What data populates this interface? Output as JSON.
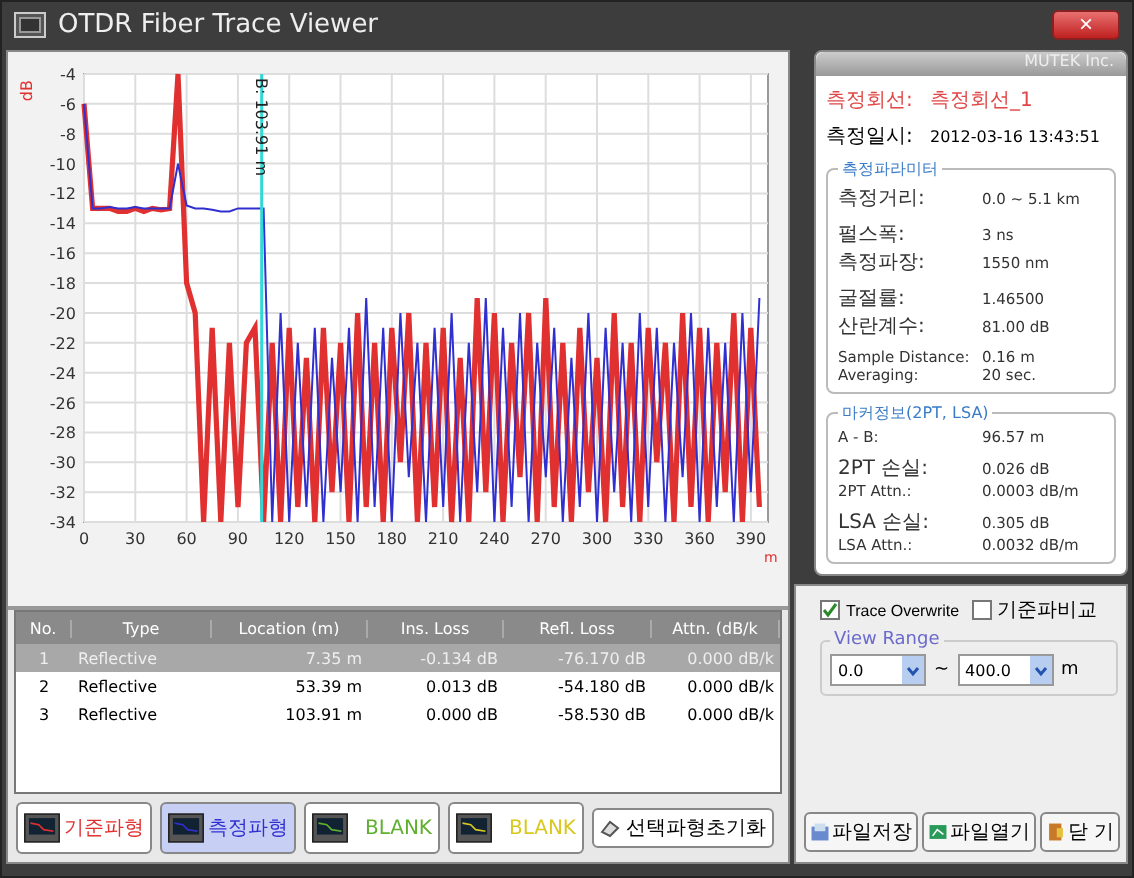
{
  "window": {
    "title": "OTDR Fiber Trace Viewer",
    "close": "×"
  },
  "chart": {
    "chart_data": {
      "type": "line",
      "grid": true,
      "ylabel": "dB",
      "xlabel": "m",
      "xlim": [
        0,
        400
      ],
      "ylim": [
        -34,
        -4
      ],
      "annotations": [
        {
          "x": 103.91,
          "text": "B: 103.91 m"
        }
      ],
      "xticks": [
        0,
        30,
        60,
        90,
        120,
        150,
        180,
        210,
        240,
        270,
        300,
        330,
        360,
        390
      ],
      "yticks": [
        -4,
        -6,
        -8,
        -10,
        -12,
        -14,
        -16,
        -18,
        -20,
        -22,
        -24,
        -26,
        -28,
        -30,
        -32,
        -34
      ],
      "x": [
        0,
        5,
        10,
        15,
        20,
        25,
        30,
        35,
        40,
        45,
        50,
        55,
        60,
        65,
        70,
        75,
        80,
        85,
        90,
        95,
        100,
        105,
        110,
        115,
        120,
        125,
        130,
        135,
        140,
        145,
        150,
        155,
        160,
        165,
        170,
        175,
        180,
        185,
        190,
        195,
        200,
        205,
        210,
        215,
        220,
        225,
        230,
        235,
        240,
        245,
        250,
        255,
        260,
        265,
        270,
        275,
        280,
        285,
        290,
        295,
        300,
        305,
        310,
        315,
        320,
        325,
        330,
        335,
        340,
        345,
        350,
        355,
        360,
        365,
        370,
        375,
        380,
        385,
        390,
        395
      ],
      "series": [
        {
          "color": "#e03030",
          "values": [
            -6,
            -13,
            -13,
            -13,
            -13.2,
            -13.2,
            -13,
            -13.2,
            -13,
            -13.1,
            -13,
            -4,
            -18,
            -20,
            -34,
            -21,
            -34,
            -22,
            -33,
            -22,
            -21,
            -34,
            -22,
            -34,
            -21,
            -33,
            -23,
            -34,
            -21,
            -32,
            -22,
            -34,
            -20,
            -33,
            -22,
            -34,
            -21,
            -30,
            -20,
            -34,
            -22,
            -33,
            -21,
            -34,
            -23,
            -34,
            -19,
            -32,
            -20,
            -34,
            -22,
            -31,
            -20,
            -34,
            -19,
            -33,
            -22,
            -34,
            -21,
            -32,
            -23,
            -34,
            -20,
            -33,
            -22,
            -34,
            -21,
            -30,
            -22,
            -34,
            -20,
            -33,
            -21,
            -34,
            -22,
            -32,
            -20,
            -34,
            -21,
            -33
          ]
        },
        {
          "color": "#3030d0",
          "values": [
            -6,
            -13,
            -13,
            -12.9,
            -13,
            -13,
            -12.9,
            -13,
            -13,
            -13,
            -13,
            -10,
            -12.8,
            -13,
            -13,
            -13.1,
            -13.2,
            -13.2,
            -13,
            -13,
            -13,
            -13,
            -34,
            -20,
            -34,
            -22,
            -33,
            -21,
            -34,
            -23,
            -32,
            -21,
            -34,
            -19,
            -33,
            -21,
            -34,
            -20,
            -31,
            -22,
            -34,
            -21,
            -33,
            -20,
            -34,
            -22,
            -32,
            -19,
            -34,
            -21,
            -33,
            -20,
            -34,
            -22,
            -31,
            -21,
            -34,
            -23,
            -33,
            -20,
            -34,
            -21,
            -32,
            -22,
            -34,
            -20,
            -33,
            -21,
            -34,
            -22,
            -31,
            -20,
            -34,
            -21,
            -33,
            -22,
            -34,
            -20,
            -32,
            -19
          ]
        }
      ]
    }
  },
  "table": {
    "columns": [
      "No.",
      "Type",
      "Location (m)",
      "Ins. Loss",
      "Refl. Loss",
      "Attn. (dB/k"
    ],
    "rows": [
      {
        "selected": true,
        "cells": [
          "1",
          "Reflective",
          "7.35 m",
          "-0.134 dB",
          "-76.170 dB",
          "0.000 dB/k"
        ]
      },
      {
        "selected": false,
        "cells": [
          "2",
          "Reflective",
          "53.39 m",
          "0.013 dB",
          "-54.180 dB",
          "0.000 dB/k"
        ]
      },
      {
        "selected": false,
        "cells": [
          "3",
          "Reflective",
          "103.91 m",
          "0.000 dB",
          "-58.530 dB",
          "0.000 dB/k"
        ]
      }
    ]
  },
  "trace_buttons": [
    {
      "label": "기준파형",
      "color": "#e03030",
      "selected": false
    },
    {
      "label": "측정파형",
      "color": "#3030d0",
      "selected": true
    },
    {
      "label": "BLANK",
      "color": "#60b030",
      "selected": false
    },
    {
      "label": "BLANK",
      "color": "#d8c820",
      "selected": false
    }
  ],
  "reset_button": "선택파형초기화",
  "info": {
    "brand": "MUTEK Inc.",
    "line": {
      "label": "측정회선:",
      "value": "측정회선_1"
    },
    "date": {
      "label": "측정일시:",
      "value": "2012-03-16 13:43:51"
    }
  },
  "params": {
    "title": "측정파라미터",
    "groups": [
      [
        [
          "측정거리:",
          "0.0 ~ 5.1 km"
        ]
      ],
      [
        [
          "펄스폭:",
          "3 ns"
        ],
        [
          "측정파장:",
          "1550 nm"
        ]
      ],
      [
        [
          "굴절률:",
          "1.46500"
        ],
        [
          "산란계수:",
          "81.00 dB"
        ]
      ],
      [
        [
          "Sample Distance:",
          "0.16 m"
        ],
        [
          "Averaging:",
          "20 sec."
        ]
      ]
    ]
  },
  "marker_info": {
    "title": "마커정보(2PT, LSA)",
    "groups": [
      [
        [
          "A - B:",
          "96.57 m"
        ]
      ],
      [
        [
          "2PT 손실:",
          "0.026 dB"
        ],
        [
          "2PT Attn.:",
          "0.0003 dB/m"
        ]
      ],
      [
        [
          "LSA 손실:",
          "0.305 dB"
        ],
        [
          "LSA Attn.:",
          "0.0032 dB/m"
        ]
      ]
    ]
  },
  "options": [
    {
      "label": "Trace Overwrite",
      "checked": true
    },
    {
      "label": "기준파비교",
      "checked": false
    }
  ],
  "view_range": {
    "title": "View Range",
    "from": "0.0",
    "separator": "~",
    "to": "400.0",
    "unit": "m"
  },
  "actions": [
    {
      "kind": "save",
      "label": "파일저장"
    },
    {
      "kind": "open",
      "label": "파일열기"
    },
    {
      "kind": "close",
      "label": "닫 기"
    }
  ]
}
